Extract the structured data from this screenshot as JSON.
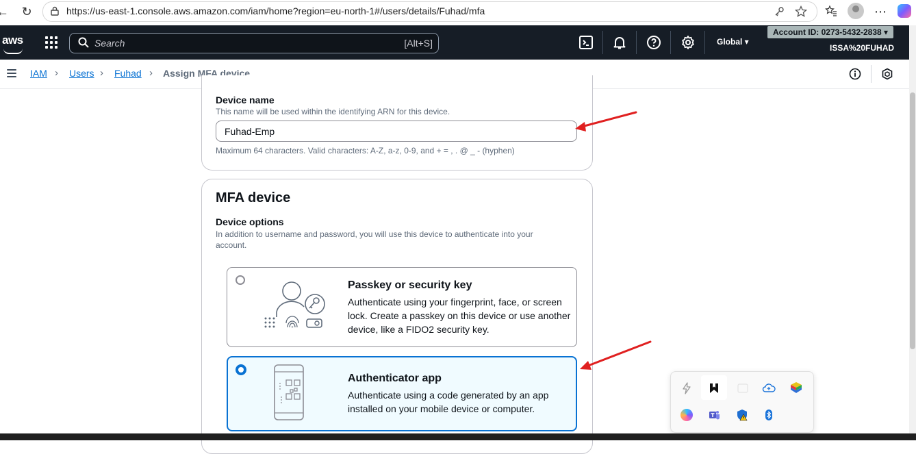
{
  "browser": {
    "url": "https://us-east-1.console.aws.amazon.com/iam/home?region=eu-north-1#/users/details/Fuhad/mfa"
  },
  "aws_header": {
    "logo_text": "aws",
    "search_placeholder": "Search",
    "search_shortcut": "[Alt+S]",
    "region": "Global ▾",
    "account_id": "Account ID: 0273-5432-2838 ▾",
    "user": "ISSA%20FUHAD"
  },
  "breadcrumb": {
    "items": [
      "IAM",
      "Users",
      "Fuhad"
    ],
    "current": "Assign MFA device"
  },
  "device_name_section": {
    "label": "Device name",
    "description": "This name will be used within the identifying ARN for this device.",
    "value": "Fuhad-Emp",
    "constraint": "Maximum 64 characters. Valid characters: A-Z, a-z, 0-9, and + = , . @ _ - (hyphen)"
  },
  "mfa_section": {
    "title": "MFA device",
    "options_label": "Device options",
    "options_description": "In addition to username and password, you will use this device to authenticate into your account.",
    "options": [
      {
        "title": "Passkey or security key",
        "description": "Authenticate using your fingerprint, face, or screen lock. Create a passkey on this device or use another device, like a FIDO2 security key.",
        "selected": false
      },
      {
        "title": "Authenticator app",
        "description": "Authenticate using a code generated by an app installed on your mobile device or computer.",
        "selected": true
      }
    ]
  },
  "colors": {
    "accent": "#0972d3",
    "header_bg": "#161d26",
    "annotation_arrow": "#e02020"
  }
}
